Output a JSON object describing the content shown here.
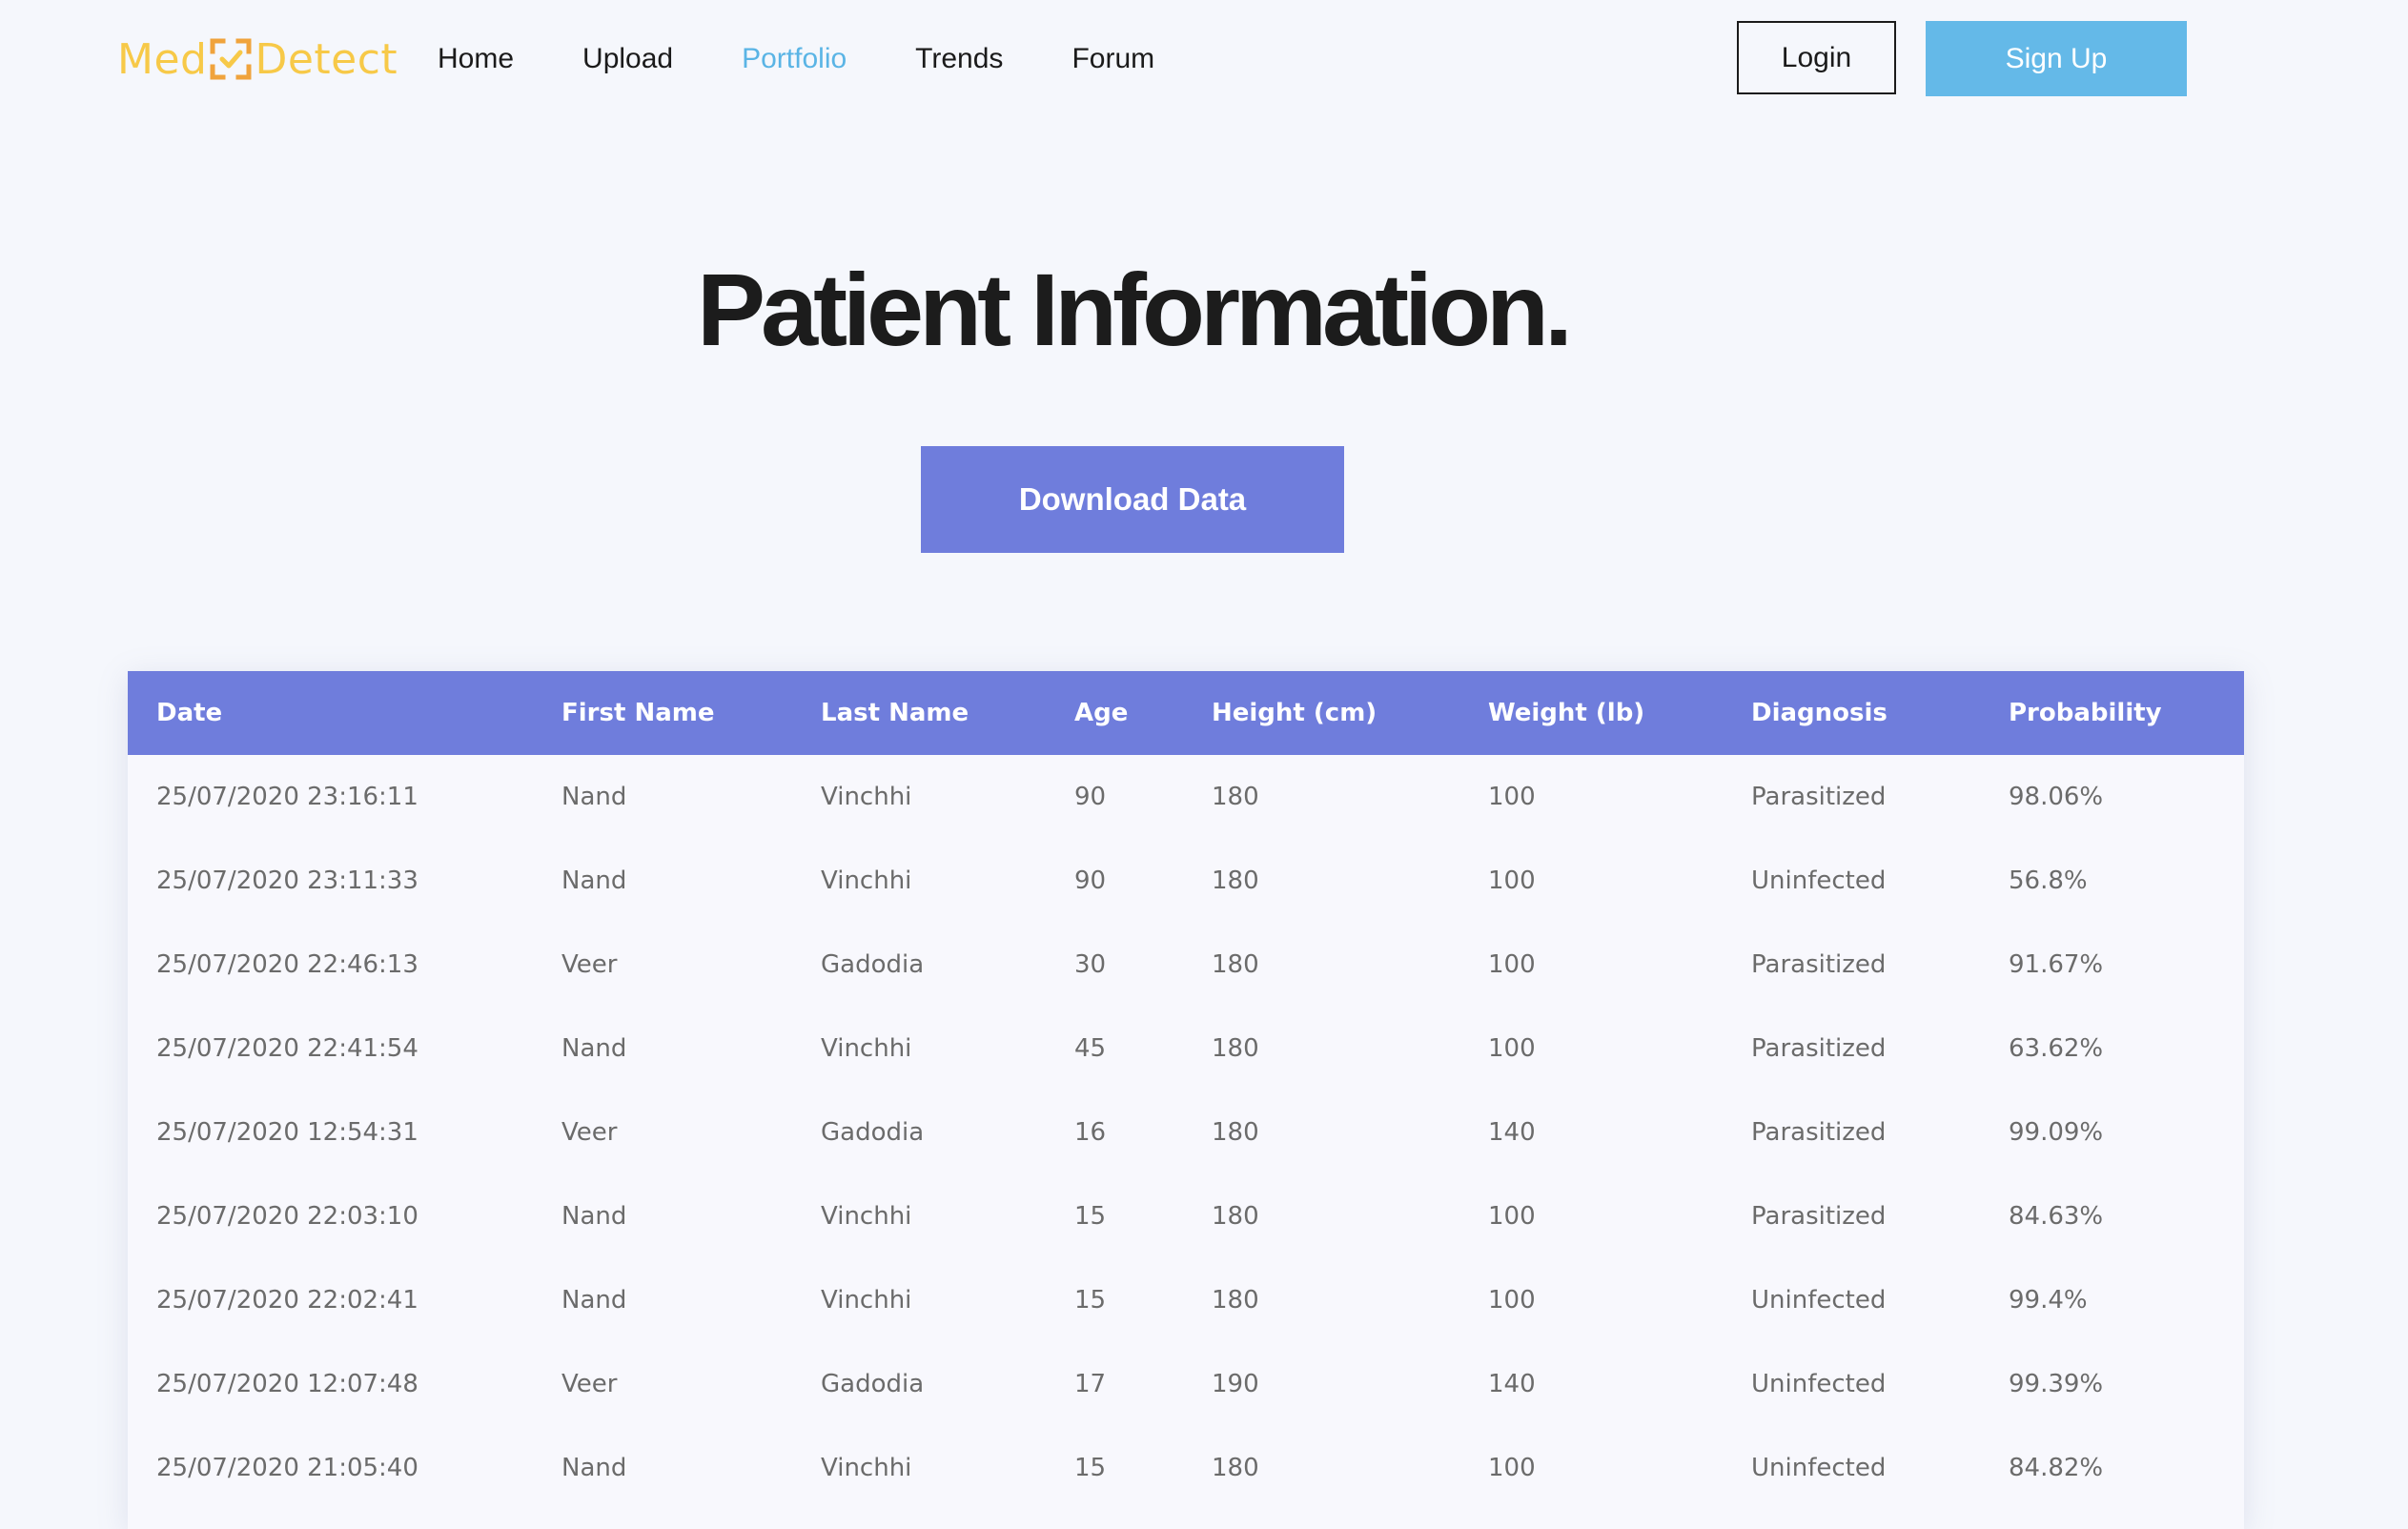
{
  "brand": {
    "logo_left": "Med",
    "logo_right": "Detect",
    "colors": {
      "logo": "#f7c948",
      "logo_mark": "#f0a33c",
      "accent": "#6f7ddc",
      "signup": "#64b9e8",
      "nav_active": "#5ab4e5"
    }
  },
  "nav": {
    "items": [
      {
        "label": "Home",
        "active": false
      },
      {
        "label": "Upload",
        "active": false
      },
      {
        "label": "Portfolio",
        "active": true
      },
      {
        "label": "Trends",
        "active": false
      },
      {
        "label": "Forum",
        "active": false
      }
    ]
  },
  "auth": {
    "login_label": "Login",
    "signup_label": "Sign Up"
  },
  "hero": {
    "title": "Patient Information.",
    "download_label": "Download Data"
  },
  "table": {
    "columns": [
      "Date",
      "First Name",
      "Last Name",
      "Age",
      "Height (cm)",
      "Weight (lb)",
      "Diagnosis",
      "Probability"
    ],
    "rows": [
      [
        "25/07/2020 23:16:11",
        "Nand",
        "Vinchhi",
        "90",
        "180",
        "100",
        "Parasitized",
        "98.06%"
      ],
      [
        "25/07/2020 23:11:33",
        "Nand",
        "Vinchhi",
        "90",
        "180",
        "100",
        "Uninfected",
        "56.8%"
      ],
      [
        "25/07/2020 22:46:13",
        "Veer",
        "Gadodia",
        "30",
        "180",
        "100",
        "Parasitized",
        "91.67%"
      ],
      [
        "25/07/2020 22:41:54",
        "Nand",
        "Vinchhi",
        "45",
        "180",
        "100",
        "Parasitized",
        "63.62%"
      ],
      [
        "25/07/2020 12:54:31",
        "Veer",
        "Gadodia",
        "16",
        "180",
        "140",
        "Parasitized",
        "99.09%"
      ],
      [
        "25/07/2020 22:03:10",
        "Nand",
        "Vinchhi",
        "15",
        "180",
        "100",
        "Parasitized",
        "84.63%"
      ],
      [
        "25/07/2020 22:02:41",
        "Nand",
        "Vinchhi",
        "15",
        "180",
        "100",
        "Uninfected",
        "99.4%"
      ],
      [
        "25/07/2020 12:07:48",
        "Veer",
        "Gadodia",
        "17",
        "190",
        "140",
        "Uninfected",
        "99.39%"
      ],
      [
        "25/07/2020 21:05:40",
        "Nand",
        "Vinchhi",
        "15",
        "180",
        "100",
        "Uninfected",
        "84.82%"
      ]
    ]
  }
}
